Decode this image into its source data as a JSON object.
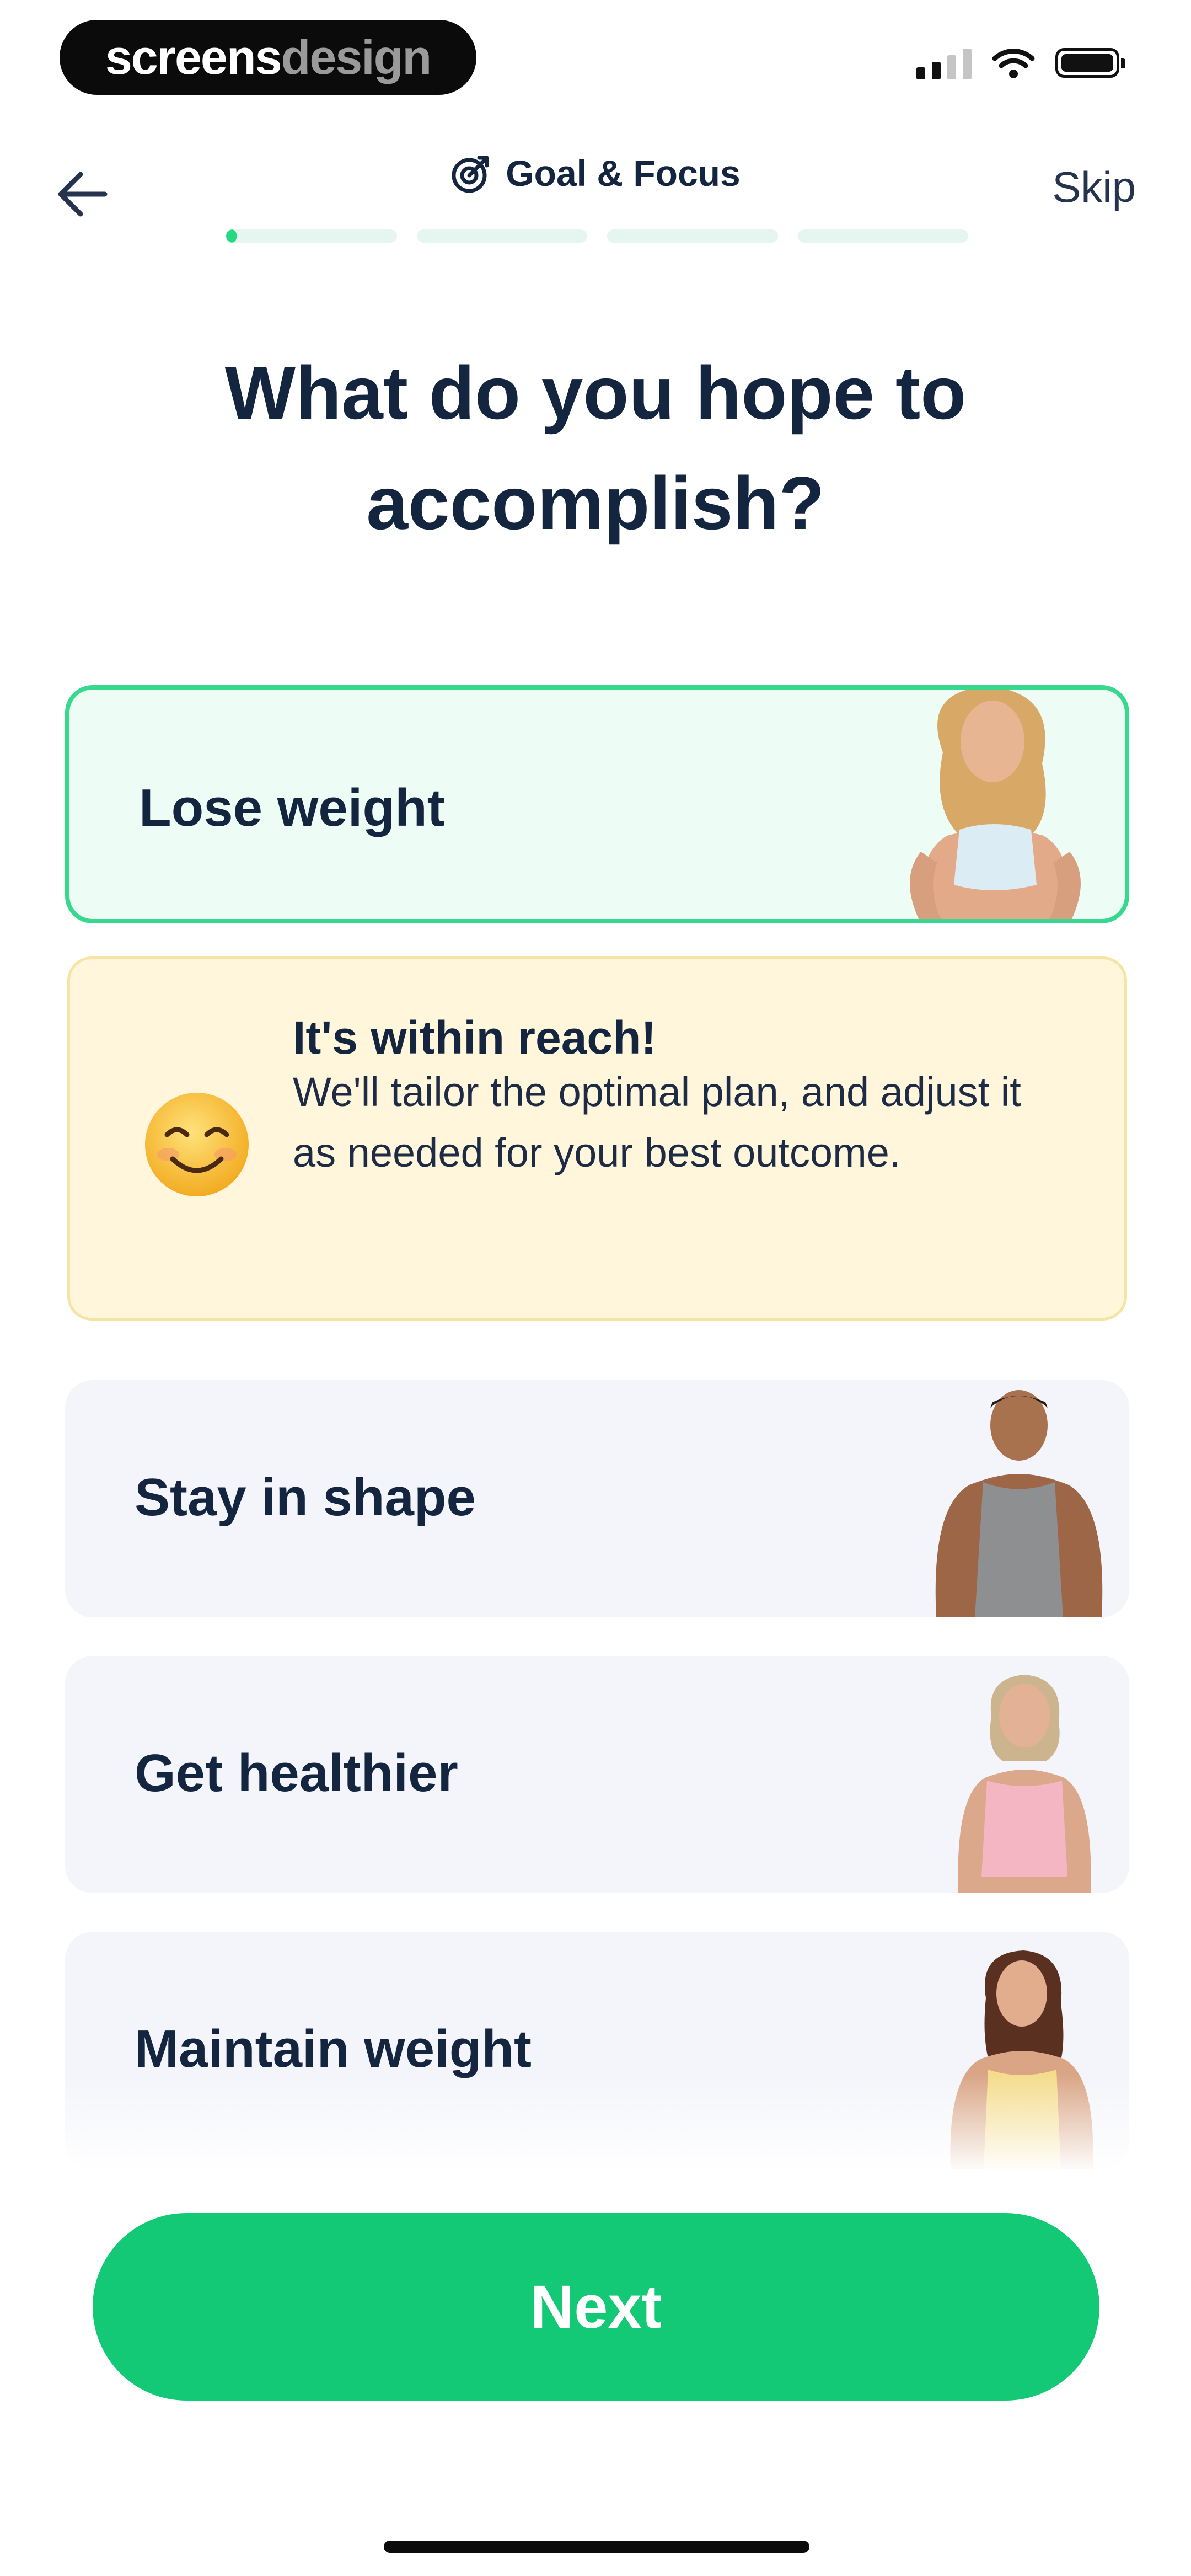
{
  "status_bar": {
    "brand_white": "screens",
    "brand_gray": "design"
  },
  "header": {
    "title": "Goal & Focus",
    "skip_label": "Skip",
    "progress": {
      "steps": 4,
      "current_step": 1,
      "current_step_fill": 0.06
    }
  },
  "question": {
    "title": "What do you hope to accomplish?"
  },
  "options": [
    {
      "label": "Lose weight",
      "selected": true,
      "icon": "woman-white-top-photo"
    },
    {
      "label": "Stay in shape",
      "selected": false,
      "icon": "man-gray-tank-photo"
    },
    {
      "label": "Get healthier",
      "selected": false,
      "icon": "woman-pink-top-photo"
    },
    {
      "label": "Maintain weight",
      "selected": false,
      "icon": "woman-yellow-tank-photo"
    }
  ],
  "info_card": {
    "icon": "smiling-face-emoji",
    "title": "It's within reach!",
    "body": "We'll tailor the optimal plan, and adjust it as needed for your best outcome."
  },
  "next_button": {
    "label": "Next"
  },
  "colors": {
    "accent_green": "#14c975",
    "selected_border": "#36d98e",
    "selected_bg": "#eefcf6",
    "info_bg": "#fff6dc",
    "text_dark": "#14253f"
  }
}
